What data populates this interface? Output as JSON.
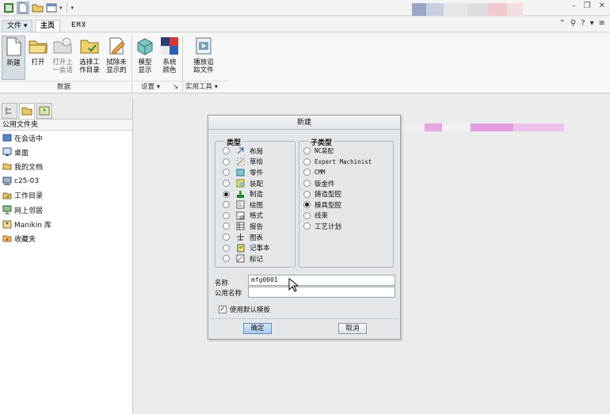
{
  "app": {
    "quick_access": [
      {
        "icon": "app-logo-icon"
      },
      {
        "icon": "new-file-icon"
      },
      {
        "icon": "open-folder-icon"
      },
      {
        "icon": "window-icon"
      },
      {
        "icon": "dropdown-arrow-icon"
      }
    ]
  },
  "tabs": [
    {
      "label": "文件 ▾"
    },
    {
      "label": "主页"
    },
    {
      "label": "EMX"
    }
  ],
  "ribbon": {
    "buttons": [
      {
        "label": "新建",
        "icon": "new-document-icon"
      },
      {
        "label": "打开",
        "icon": "open-folder-icon"
      },
      {
        "label": "打开上\n一会话",
        "icon": "open-last-session-icon"
      },
      {
        "label": "选择工\n作目录",
        "icon": "select-working-dir-icon"
      },
      {
        "label": "拭除未\n显示的",
        "icon": "erase-not-displayed-icon"
      },
      {
        "label": "模型\n显示",
        "icon": "model-display-icon"
      },
      {
        "label": "系统\n颜色",
        "icon": "system-colors-icon"
      },
      {
        "label": "播放追\n踪文件",
        "icon": "play-trail-file-icon"
      }
    ],
    "groups": [
      {
        "label": "数据"
      },
      {
        "label": "设置 ▾"
      },
      {
        "label": "实用工具 ▾"
      }
    ]
  },
  "left_panel": {
    "header": "公用文件夹",
    "items": [
      {
        "label": "在会话中",
        "icon": "session-icon"
      },
      {
        "label": "桌面",
        "icon": "desktop-icon"
      },
      {
        "label": "我的文档",
        "icon": "my-documents-icon"
      },
      {
        "label": "c25-03",
        "icon": "computer-icon"
      },
      {
        "label": "工作目录",
        "icon": "working-directory-icon"
      },
      {
        "label": "网上邻居",
        "icon": "network-icon"
      },
      {
        "label": "Manikin 库",
        "icon": "manikin-library-icon"
      },
      {
        "label": "收藏夹",
        "icon": "favorites-icon"
      }
    ]
  },
  "dialog": {
    "title": "新建",
    "type_title": "类型",
    "types": [
      {
        "label": "布局",
        "selected": false,
        "icon": "layout-icon"
      },
      {
        "label": "草绘",
        "selected": false,
        "icon": "sketch-icon"
      },
      {
        "label": "零件",
        "selected": false,
        "icon": "part-icon"
      },
      {
        "label": "装配",
        "selected": false,
        "icon": "assembly-icon"
      },
      {
        "label": "制造",
        "selected": true,
        "icon": "manufacturing-icon"
      },
      {
        "label": "绘图",
        "selected": false,
        "icon": "drawing-icon"
      },
      {
        "label": "格式",
        "selected": false,
        "icon": "format-icon"
      },
      {
        "label": "报告",
        "selected": false,
        "icon": "report-icon"
      },
      {
        "label": "图表",
        "selected": false,
        "icon": "diagram-icon"
      },
      {
        "label": "记事本",
        "selected": false,
        "icon": "notebook-icon"
      },
      {
        "label": "标记",
        "selected": false,
        "icon": "markup-icon"
      }
    ],
    "subtype_title": "子类型",
    "subtypes": [
      {
        "label": "NC装配",
        "selected": false
      },
      {
        "label": "Expert Machinist",
        "selected": false
      },
      {
        "label": "CMM",
        "selected": false
      },
      {
        "label": "钣金件",
        "selected": false
      },
      {
        "label": "铸造型腔",
        "selected": false
      },
      {
        "label": "模具型腔",
        "selected": true
      },
      {
        "label": "线束",
        "selected": false
      },
      {
        "label": "工艺计划",
        "selected": false
      }
    ],
    "name_label": "名称",
    "name_value": "mfg0001",
    "common_name_label": "公用名称",
    "common_name_value": "",
    "use_default_template_label": "使用默认模板",
    "use_default_template_checked": true,
    "ok_label": "确定",
    "cancel_label": "取消"
  },
  "colors": {
    "accent": "#a9c9ec",
    "ribbon_bg": "#f7f7f7",
    "dialog_bg": "#e4e7ea"
  }
}
